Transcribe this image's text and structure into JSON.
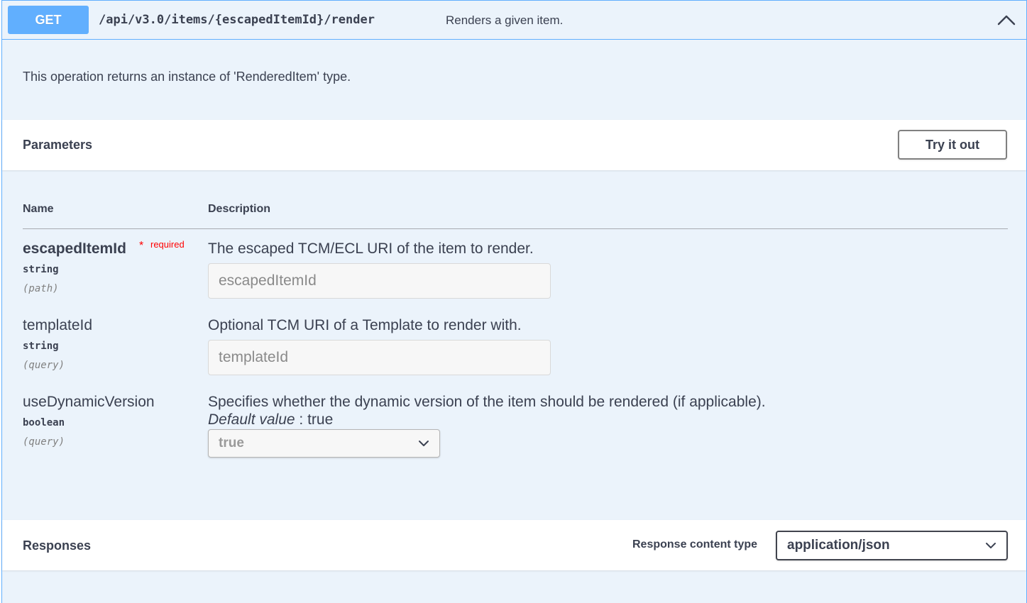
{
  "summary": {
    "method": "GET",
    "path": "/api/v3.0/items/{escapedItemId}/render",
    "description": "Renders a given item."
  },
  "operation_description": "This operation returns an instance of 'RenderedItem' type.",
  "parameters": {
    "title": "Parameters",
    "try_button": "Try it out",
    "columns": {
      "name": "Name",
      "description": "Description"
    },
    "items": [
      {
        "name": "escapedItemId",
        "required_star": "*",
        "required_label": "required",
        "type": "string",
        "in": "(path)",
        "description": "The escaped TCM/ECL URI of the item to render.",
        "placeholder": "escapedItemId"
      },
      {
        "name": "templateId",
        "type": "string",
        "in": "(query)",
        "description": "Optional TCM URI of a Template to render with.",
        "placeholder": "templateId"
      },
      {
        "name": "useDynamicVersion",
        "type": "boolean",
        "in": "(query)",
        "description": "Specifies whether the dynamic version of the item should be rendered (if applicable).",
        "default_label": "Default value",
        "default_sep": " : ",
        "default_value": "true",
        "selected": "true"
      }
    ]
  },
  "responses": {
    "title": "Responses",
    "content_type_label": "Response content type",
    "content_type_selected": "application/json"
  },
  "colors": {
    "get_method": "#61affe",
    "block_bg": "#ebf3fb",
    "required": "#ff0000",
    "text": "#3b4151"
  },
  "icons": {
    "collapse": "chevron-up-icon",
    "select": "chevron-down-icon"
  }
}
